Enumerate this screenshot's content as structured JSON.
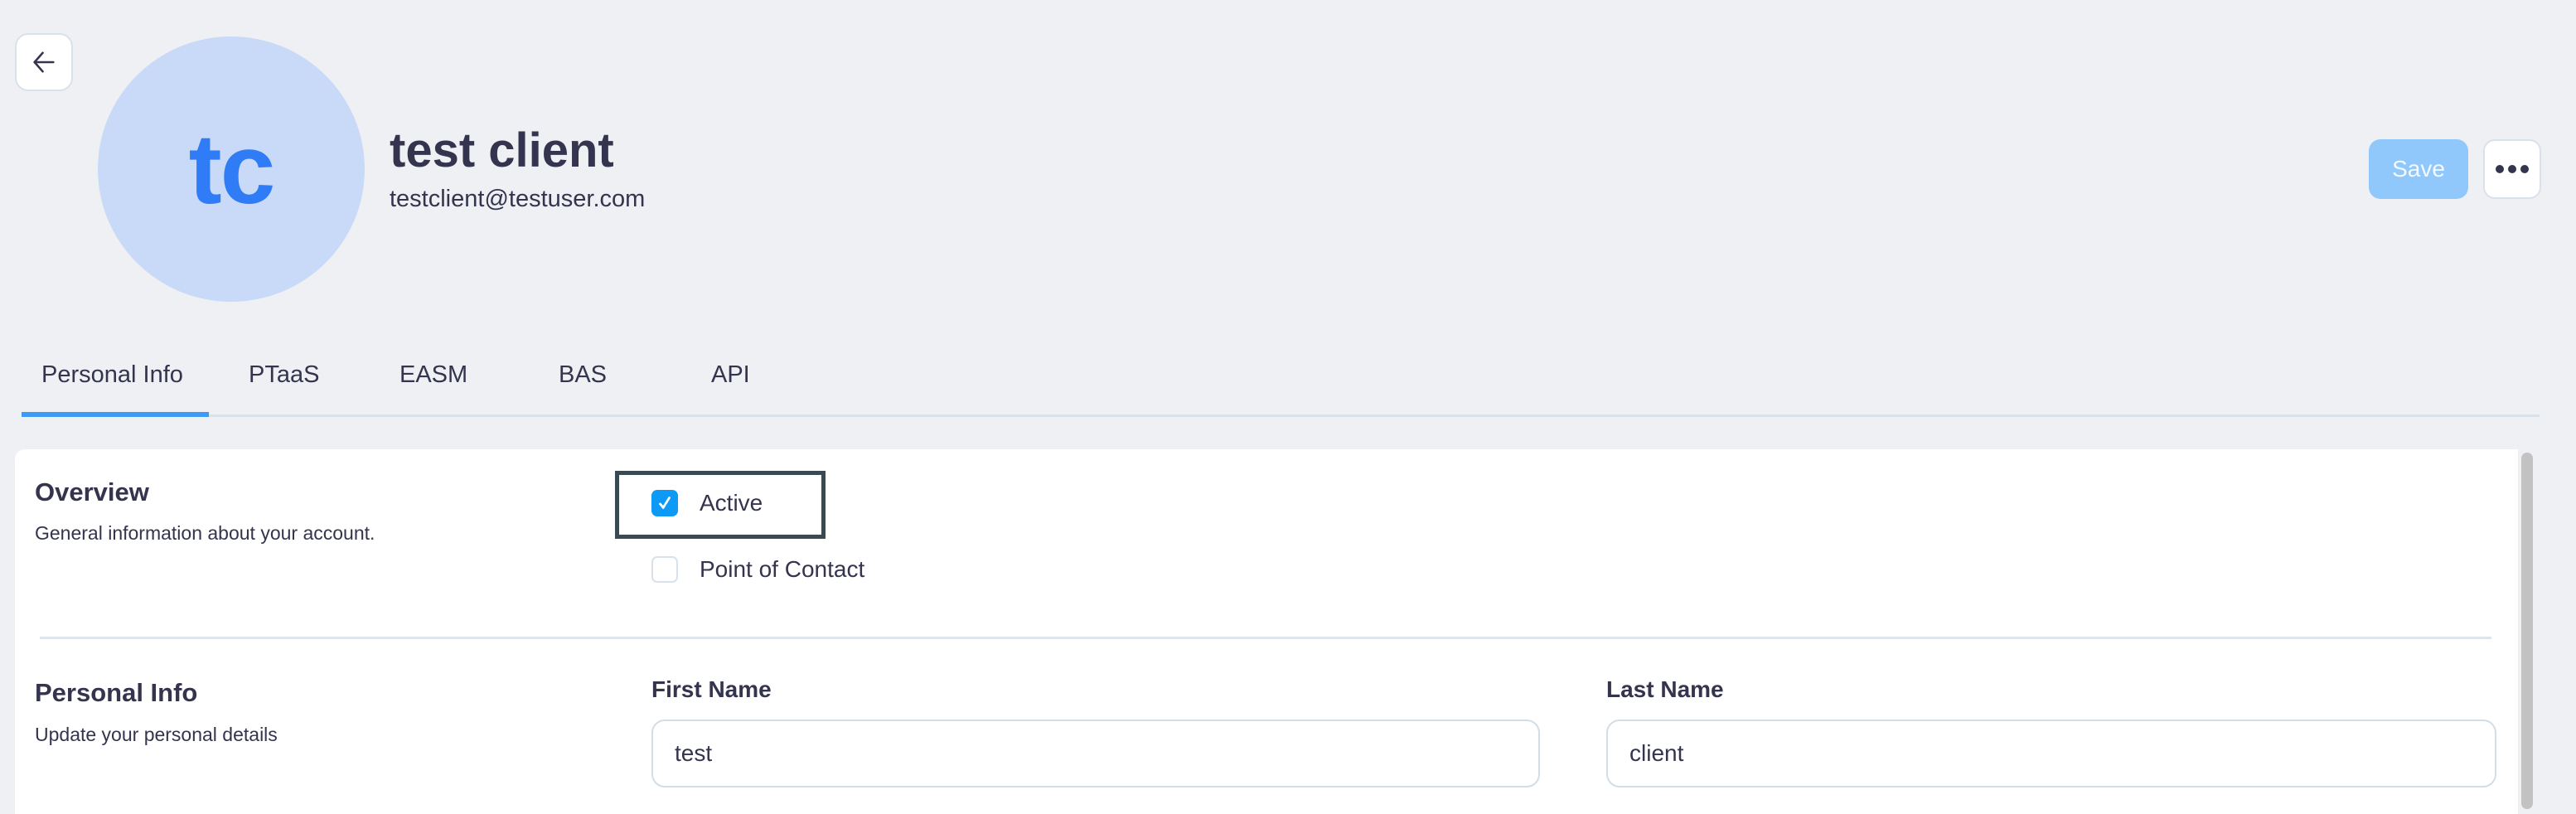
{
  "header": {
    "avatar_initials": "tc",
    "user_name": "test client",
    "user_email": "testclient@testuser.com",
    "save_label": "Save",
    "back_icon": "arrow-left-icon",
    "more_icon": "more-horizontal-icon"
  },
  "tabs": [
    {
      "label": "Personal Info",
      "active": true
    },
    {
      "label": "PTaaS",
      "active": false
    },
    {
      "label": "EASM",
      "active": false
    },
    {
      "label": "BAS",
      "active": false
    },
    {
      "label": "API",
      "active": false
    }
  ],
  "overview": {
    "title": "Overview",
    "description": "General information about your account.",
    "options": [
      {
        "label": "Active",
        "checked": true
      },
      {
        "label": "Point of Contact",
        "checked": false
      }
    ]
  },
  "personal_info": {
    "title": "Personal Info",
    "description": "Update your personal details",
    "first_name": {
      "label": "First Name",
      "value": "test"
    },
    "last_name": {
      "label": "Last Name",
      "value": "client"
    }
  },
  "colors": {
    "accent": "#3d9af5",
    "checkbox_checked": "#0d9af7",
    "avatar_bg": "#c8daf7",
    "avatar_text": "#2f7cf6",
    "save_disabled": "#90c8fc"
  }
}
